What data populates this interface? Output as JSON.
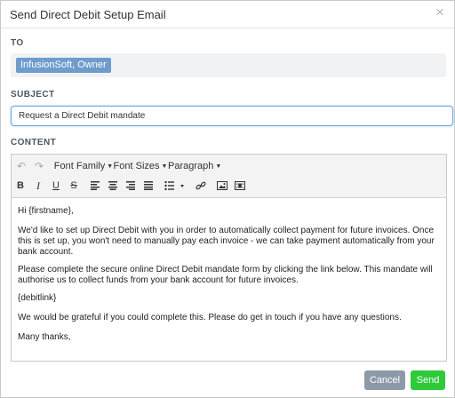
{
  "dialog": {
    "title": "Send Direct Debit Setup Email",
    "close_icon": "×"
  },
  "to": {
    "label": "TO",
    "recipient": "InfusionSoft, Owner"
  },
  "subject": {
    "label": "SUBJECT",
    "value": "Request a Direct Debit mandate"
  },
  "content": {
    "label": "CONTENT",
    "toolbar": {
      "undo": "↶",
      "redo": "↷",
      "font_family": "Font Family",
      "font_sizes": "Font Sizes",
      "paragraph": "Paragraph",
      "caret": "▼",
      "bold": "B",
      "italic": "I",
      "underline": "U",
      "strikethrough": "S"
    },
    "paragraphs": [
      "Hi {firstname},",
      "We'd like to set up Direct Debit with you in order to automatically collect payment for future invoices. Once this is set up, you won't need to manually pay each invoice - we can take payment automatically from your bank account.",
      "Please complete the secure online Direct Debit mandate form by clicking the link below. This mandate will authorise us to collect funds from your bank account for future invoices.",
      "{debitlink}",
      "We would be grateful if you could complete this. Please do get in touch if you have any questions.",
      "Many thanks,"
    ]
  },
  "footer": {
    "cancel_label": "Cancel",
    "send_label": "Send"
  },
  "colors": {
    "recipient_tag": "#6e9ccc",
    "cancel_button": "#8c9aa7",
    "send_button": "#2fca3a",
    "focus_border": "#6aa7e0"
  }
}
